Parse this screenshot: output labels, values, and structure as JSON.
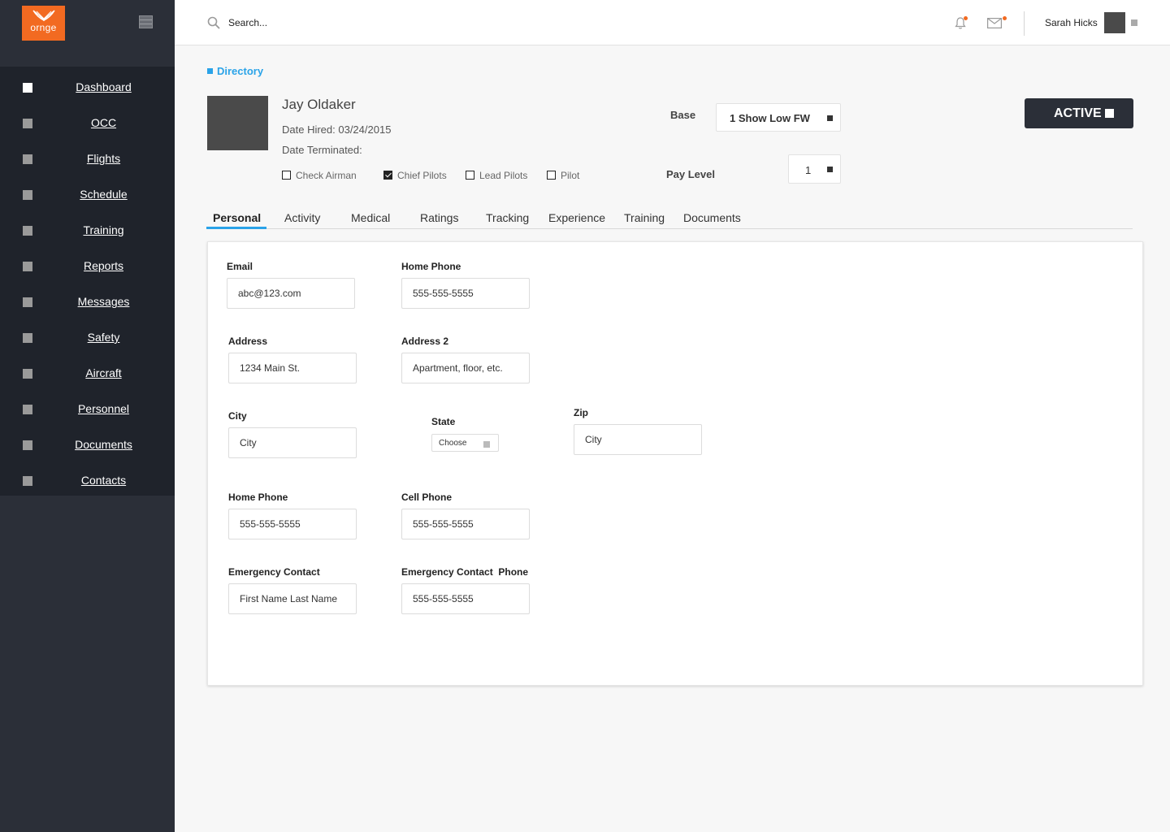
{
  "app": {
    "logo_text": "ornge"
  },
  "sidebar": {
    "items": [
      {
        "label": "Dashboard",
        "active": true
      },
      {
        "label": "OCC"
      },
      {
        "label": "Flights"
      },
      {
        "label": "Schedule"
      },
      {
        "label": "Training"
      },
      {
        "label": "Reports"
      },
      {
        "label": "Messages"
      },
      {
        "label": "Safety"
      },
      {
        "label": "Aircraft"
      },
      {
        "label": "Personnel"
      },
      {
        "label": "Documents"
      },
      {
        "label": "Contacts"
      }
    ]
  },
  "header": {
    "search_placeholder": "Search...",
    "user_name": "Sarah Hicks"
  },
  "breadcrumb": "Directory",
  "profile": {
    "name": "Jay Oldaker",
    "date_hired": "Date Hired: 03/24/2015",
    "date_terminated": "Date Terminated:",
    "roles": [
      {
        "label": "Check Airman",
        "checked": false
      },
      {
        "label": "Chief Pilots",
        "checked": true
      },
      {
        "label": "Lead Pilots",
        "checked": false
      },
      {
        "label": "Pilot",
        "checked": false
      }
    ],
    "base_label": "Base",
    "base_value": "1 Show Low FW",
    "pay_level_label": "Pay Level",
    "pay_level_value": "1",
    "status": "ACTIVE"
  },
  "tabs": [
    "Personal",
    "Activity",
    "Medical",
    "Ratings",
    "Tracking",
    "Experience",
    "Training",
    "Documents"
  ],
  "form": {
    "email_label": "Email",
    "email_value": "abc@123.com",
    "home_phone_label": "Home Phone",
    "home_phone_value": "555-555-5555",
    "address_label": "Address",
    "address_value": "1234 Main St.",
    "address2_label": "Address 2",
    "address2_placeholder": "Apartment, floor, etc.",
    "city_label": "City",
    "city_placeholder": "City",
    "state_label": "State",
    "state_value": "Choose",
    "zip_label": "Zip",
    "zip_placeholder": "City",
    "home_phone2_label": "Home Phone",
    "home_phone2_value": "555-555-5555",
    "cell_phone_label": "Cell Phone",
    "cell_phone_value": "555-555-5555",
    "emergency_contact_label": "Emergency Contact",
    "emergency_contact_placeholder": "First Name Last Name",
    "emergency_phone_label": "Emergency Contact  Phone",
    "emergency_phone_value": "555-555-5555"
  },
  "colors": {
    "brand": "#f26a21",
    "accent": "#2aa3e8",
    "sidebar": "#2b2f38",
    "sidebar_nav": "#1f232b"
  }
}
